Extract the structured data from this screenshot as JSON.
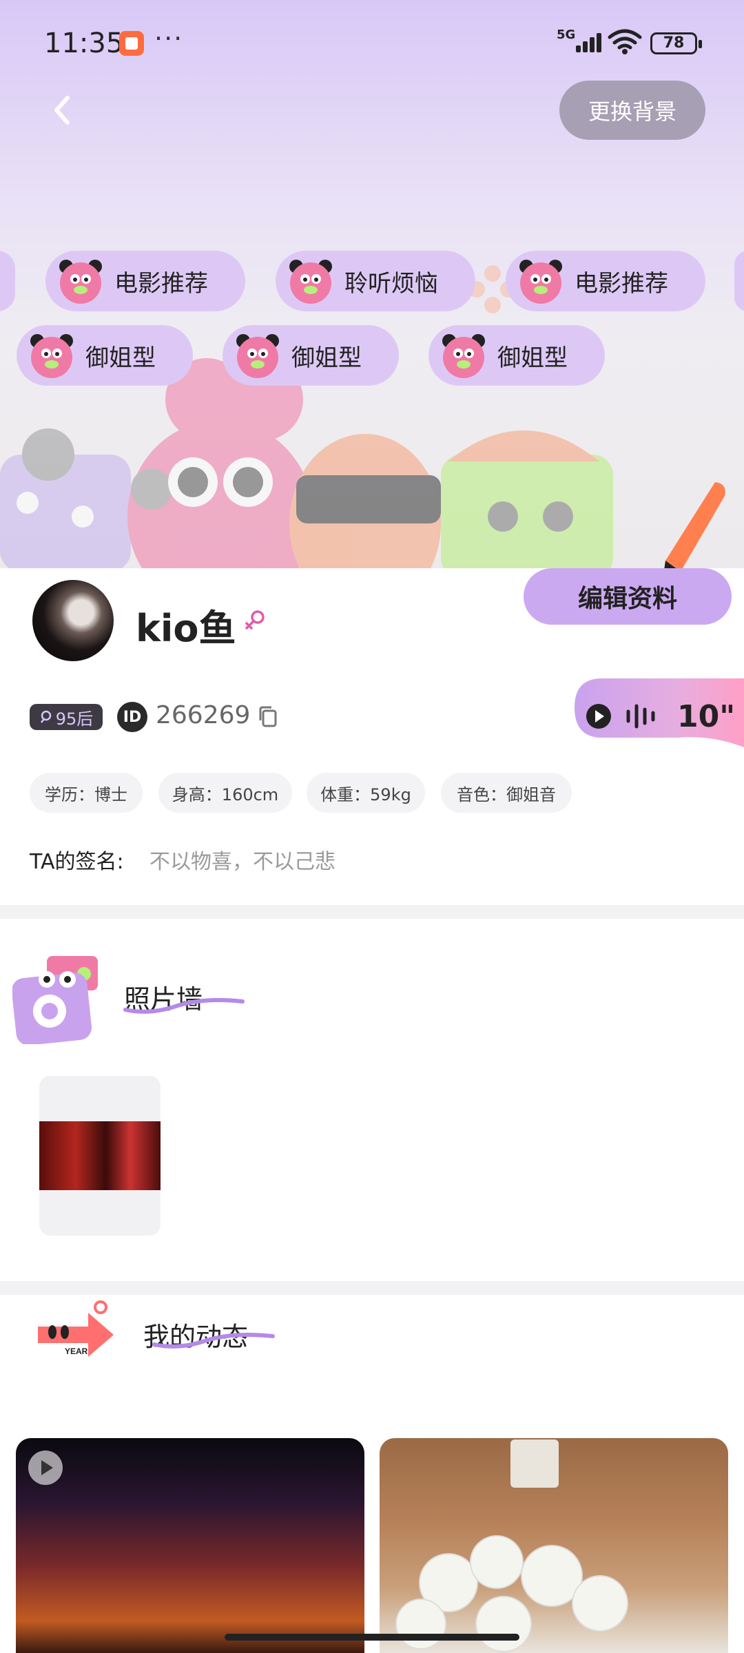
{
  "status_bar": {
    "time": "11:35",
    "network": "5G",
    "battery": "78"
  },
  "header": {
    "change_background_label": "更换背景"
  },
  "tags": {
    "row1": [
      "电影推荐",
      "聆听烦恼",
      "电影推荐"
    ],
    "row2": [
      "御姐型",
      "御姐型",
      "御姐型"
    ]
  },
  "profile": {
    "nickname": "kio鱼",
    "edit_label": "编辑资料",
    "age_tag": "95后",
    "id_badge": "ID",
    "id_number": "266269",
    "voice_duration": "10\"",
    "attributes": [
      "学历：博士",
      "身高：160cm",
      "体重：59kg",
      "音色：御姐音"
    ],
    "signature_label": "TA的签名:",
    "signature": "不以物喜，不以己悲"
  },
  "photo_wall": {
    "title": "照片墙"
  },
  "moments": {
    "title": "我的动态",
    "sticker_text": "YEAR"
  },
  "colors": {
    "accent_purple": "#cba9f1",
    "tag_bg": "#ddc8f5",
    "pink_face": "#f07aa6"
  }
}
